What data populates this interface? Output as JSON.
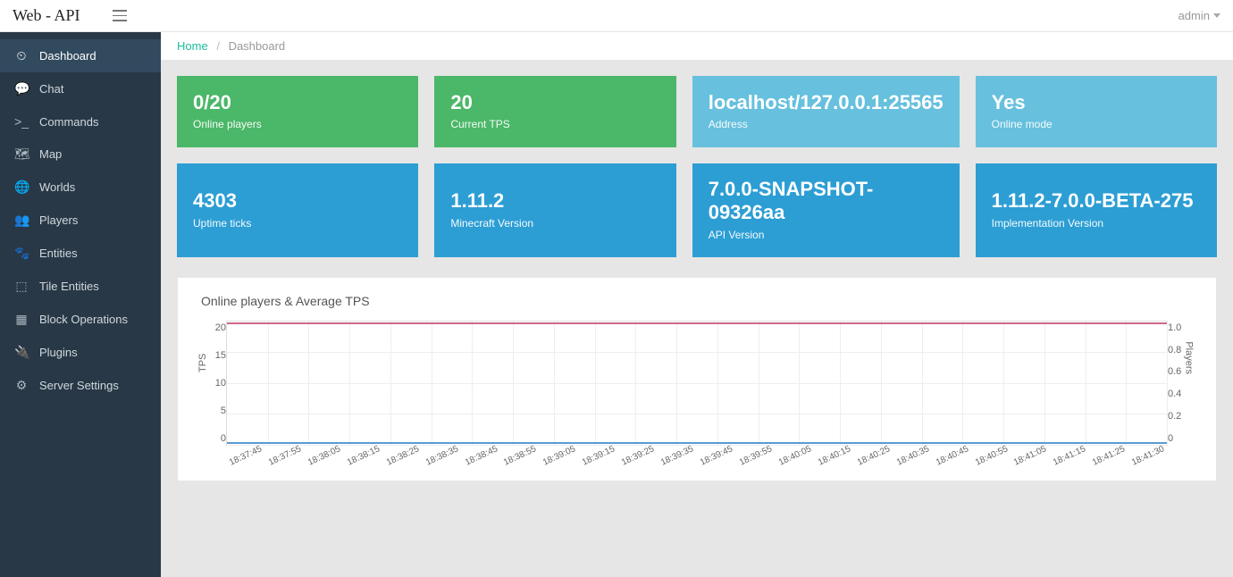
{
  "brand": "Web - API",
  "user": {
    "name": "admin"
  },
  "sidebar": {
    "items": [
      {
        "label": "Dashboard",
        "icon": "⏲",
        "active": true
      },
      {
        "label": "Chat",
        "icon": "💬",
        "active": false
      },
      {
        "label": "Commands",
        "icon": ">_",
        "active": false
      },
      {
        "label": "Map",
        "icon": "🗺",
        "active": false
      },
      {
        "label": "Worlds",
        "icon": "🌐",
        "active": false
      },
      {
        "label": "Players",
        "icon": "👥",
        "active": false
      },
      {
        "label": "Entities",
        "icon": "🐾",
        "active": false
      },
      {
        "label": "Tile Entities",
        "icon": "⬚",
        "active": false
      },
      {
        "label": "Block Operations",
        "icon": "▦",
        "active": false
      },
      {
        "label": "Plugins",
        "icon": "🔌",
        "active": false
      },
      {
        "label": "Server Settings",
        "icon": "⚙",
        "active": false
      }
    ]
  },
  "breadcrumbs": {
    "home": "Home",
    "current": "Dashboard"
  },
  "cards": [
    {
      "value": "0/20",
      "label": "Online players",
      "color": "green"
    },
    {
      "value": "20",
      "label": "Current TPS",
      "color": "green"
    },
    {
      "value": "localhost/127.0.0.1:25565",
      "label": "Address",
      "color": "lblue"
    },
    {
      "value": "Yes",
      "label": "Online mode",
      "color": "lblue"
    },
    {
      "value": "4303",
      "label": "Uptime ticks",
      "color": "blue"
    },
    {
      "value": "1.11.2",
      "label": "Minecraft Version",
      "color": "blue"
    },
    {
      "value": "7.0.0-SNAPSHOT-09326aa",
      "label": "API Version",
      "color": "blue"
    },
    {
      "value": "1.11.2-7.0.0-BETA-275",
      "label": "Implementation Version",
      "color": "blue"
    }
  ],
  "chart": {
    "title": "Online players & Average TPS",
    "y_left_label": "TPS",
    "y_right_label": "Players",
    "y_left_ticks": [
      "20",
      "15",
      "10",
      "5",
      "0"
    ],
    "y_right_ticks": [
      "1.0",
      "0.8",
      "0.6",
      "0.4",
      "0.2",
      "0"
    ]
  },
  "chart_data": {
    "type": "line",
    "title": "Online players & Average TPS",
    "categories": [
      "18:37:45",
      "18:37:55",
      "18:38:05",
      "18:38:15",
      "18:38:25",
      "18:38:35",
      "18:38:45",
      "18:38:55",
      "18:39:05",
      "18:39:15",
      "18:39:25",
      "18:39:35",
      "18:39:45",
      "18:39:55",
      "18:40:05",
      "18:40:15",
      "18:40:25",
      "18:40:35",
      "18:40:45",
      "18:40:55",
      "18:41:05",
      "18:41:15",
      "18:41:25",
      "18:41:30"
    ],
    "series": [
      {
        "name": "TPS",
        "axis": "left",
        "color": "#d06788",
        "values": [
          20,
          20,
          20,
          20,
          20,
          20,
          20,
          20,
          20,
          20,
          20,
          20,
          20,
          20,
          20,
          20,
          20,
          20,
          20,
          20,
          20,
          20,
          20,
          20
        ]
      },
      {
        "name": "Players",
        "axis": "right",
        "color": "#5a9bd4",
        "values": [
          0,
          0,
          0,
          0,
          0,
          0,
          0,
          0,
          0,
          0,
          0,
          0,
          0,
          0,
          0,
          0,
          0,
          0,
          0,
          0,
          0,
          0,
          0,
          0
        ]
      }
    ],
    "y_left": {
      "label": "TPS",
      "lim": [
        0,
        20
      ]
    },
    "y_right": {
      "label": "Players",
      "lim": [
        0,
        1.0
      ]
    }
  }
}
